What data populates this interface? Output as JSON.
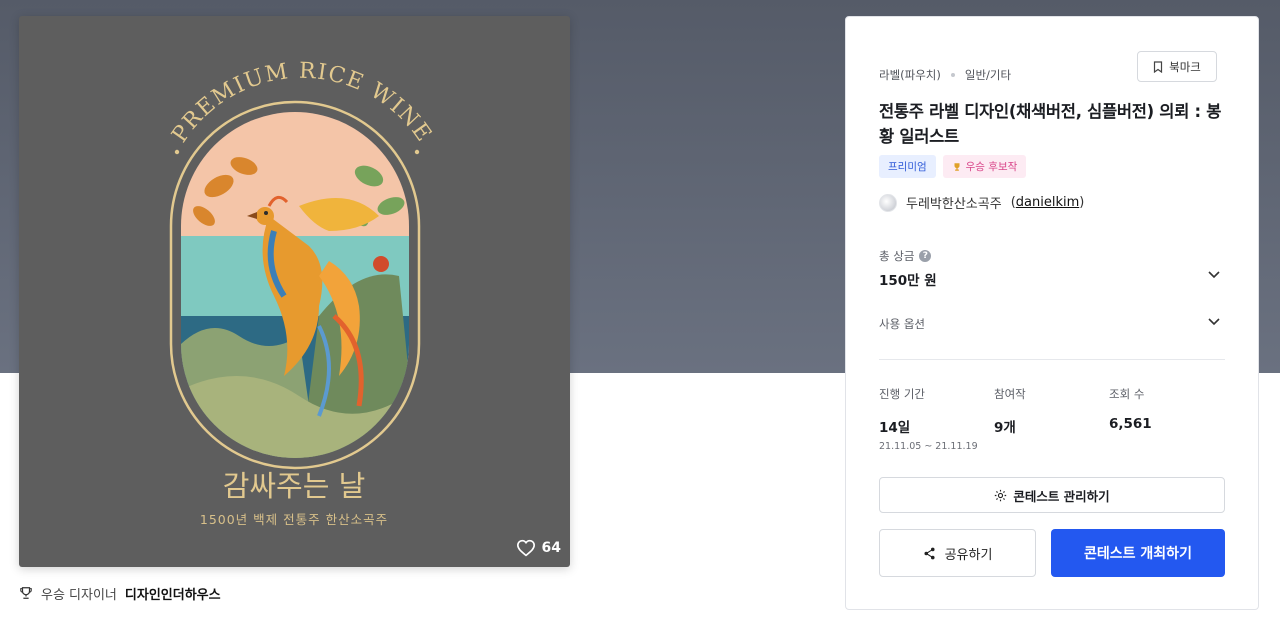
{
  "artwork": {
    "arc_text": "PREMIUM RICE WINE",
    "brand_name": "감싸주는 날",
    "subtitle": "1500년 백제 전통주 한산소곡주",
    "likes": "64"
  },
  "designer": {
    "label": "우승 디자이너",
    "name": "디자인인더하우스"
  },
  "panel": {
    "category_main": "라벨(파우치)",
    "category_sub": "일반/기타",
    "bookmark_label": "북마크",
    "title": "전통주 라벨 디자인(채색버전, 심플버전) 의뢰 : 봉황 일러스트",
    "badge_premium": "프리미엄",
    "badge_winner": "우승 후보작",
    "host_name": "두레박한산소곡주",
    "host_id_open": "(",
    "host_id": "danielkim",
    "host_id_close": ")",
    "prize_label": "총 상금",
    "prize_help": "?",
    "prize_value": "150만 원",
    "usage_label": "사용 옵션",
    "stats": {
      "period_label": "진행 기간",
      "period_value": "14일",
      "period_dates": "21.11.05 ~ 21.11.19",
      "entries_label": "참여작",
      "entries_value": "9개",
      "views_label": "조회 수",
      "views_value": "6,561"
    },
    "manage_label": "콘테스트 관리하기",
    "share_label": "공유하기",
    "open_label": "콘테스트 개최하기"
  },
  "colors": {
    "primary": "#2358f0",
    "hero_bg": "#5f6674",
    "art_bg": "#5e5e5e",
    "gold": "#e2c98f"
  }
}
